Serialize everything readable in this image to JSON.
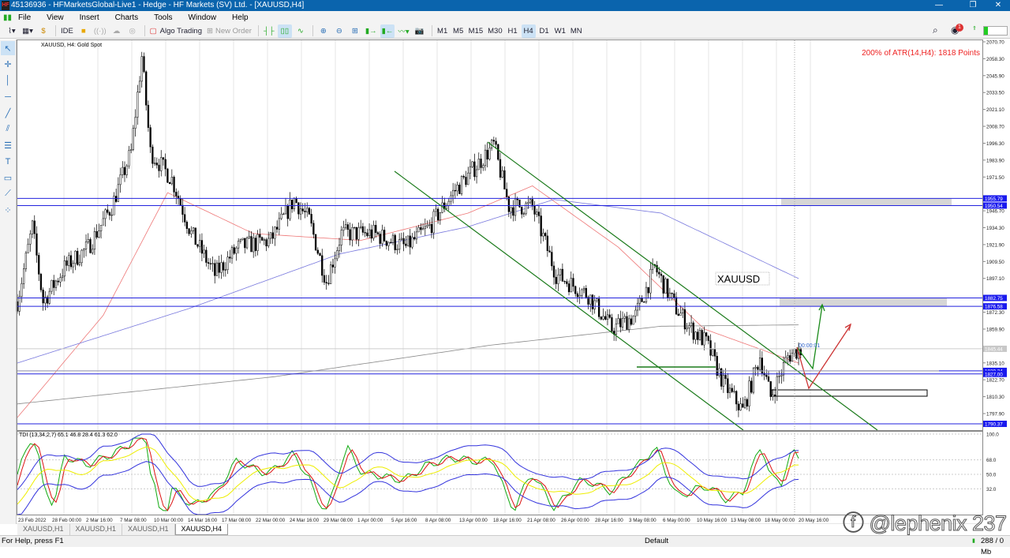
{
  "window": {
    "title": "45136936 - HFMarketsGlobal-Live1 - Hedge - HF Markets (SV) Ltd. - [XAUUSD,H4]",
    "logo": "HF"
  },
  "menu": [
    "File",
    "View",
    "Insert",
    "Charts",
    "Tools",
    "Window",
    "Help"
  ],
  "toolbar": {
    "ide": "IDE",
    "algo_trading": "Algo Trading",
    "new_order": "New Order",
    "timeframes": [
      "M1",
      "M5",
      "M15",
      "M30",
      "H1",
      "H4",
      "D1",
      "W1",
      "MN"
    ],
    "active_timeframe": "H4",
    "notifications": "1"
  },
  "chart": {
    "symbol_label": "XAUUSD, H4:  Gold Spot",
    "atr_text": "200% of ATR(14,H4): 1818  Points",
    "object_label": "XAUUSD",
    "countdown": "00:00:01",
    "indicator_label": "TDI (13,34,2,7) 65.1 46.8 28.4 61.3 62.0",
    "price_ticks": [
      "2070.70",
      "2058.30",
      "2045.90",
      "2033.50",
      "2021.10",
      "2008.70",
      "1996.30",
      "1983.90",
      "1971.50",
      "1946.70",
      "1934.30",
      "1921.90",
      "1909.50",
      "1897.10",
      "1872.30",
      "1859.90",
      "1835.10",
      "1822.70",
      "1810.30",
      "1797.90"
    ],
    "levels": [
      {
        "price": 1955.79,
        "label": "1955.79"
      },
      {
        "price": 1950.54,
        "label": "1950.54"
      },
      {
        "price": 1882.75,
        "label": "1882.75"
      },
      {
        "price": 1876.58,
        "label": "1876.58"
      },
      {
        "price": 1829.24,
        "label": "1829.24"
      },
      {
        "price": 1827.0,
        "label": "1827.00"
      },
      {
        "price": 1790.37,
        "label": "1790.37"
      }
    ],
    "bid": {
      "price": 1845.44,
      "label": "1845.44"
    },
    "indicator_ticks": [
      "100.0",
      "68.0",
      "50.0",
      "32.0"
    ],
    "time_labels": [
      "23 Feb 2022",
      "28 Feb 00:00",
      "2 Mar 16:00",
      "7 Mar 08:00",
      "10 Mar 00:00",
      "14 Mar 16:00",
      "17 Mar 08:00",
      "22 Mar 00:00",
      "24 Mar 16:00",
      "29 Mar 08:00",
      "1 Apr 00:00",
      "5 Apr 16:00",
      "8 Apr 08:00",
      "13 Apr 00:00",
      "18 Apr 16:00",
      "21 Apr 08:00",
      "26 Apr 00:00",
      "28 Apr 16:00",
      "3 May 08:00",
      "6 May 00:00",
      "10 May 16:00",
      "13 May 08:00",
      "18 May 00:00",
      "20 May 16:00"
    ]
  },
  "chart_data": {
    "type": "candlestick",
    "symbol": "XAUUSD",
    "timeframe": "H4",
    "ylim": [
      1785,
      2075
    ],
    "close_waypoints": [
      [
        0,
        1880
      ],
      [
        7,
        1935
      ],
      [
        12,
        1880
      ],
      [
        22,
        1905
      ],
      [
        33,
        1920
      ],
      [
        44,
        1950
      ],
      [
        53,
        1990
      ],
      [
        58,
        2060
      ],
      [
        62,
        1990
      ],
      [
        72,
        1970
      ],
      [
        81,
        1930
      ],
      [
        92,
        1900
      ],
      [
        103,
        1920
      ],
      [
        118,
        1925
      ],
      [
        129,
        1955
      ],
      [
        136,
        1940
      ],
      [
        144,
        1895
      ],
      [
        151,
        1930
      ],
      [
        166,
        1930
      ],
      [
        181,
        1920
      ],
      [
        192,
        1935
      ],
      [
        203,
        1960
      ],
      [
        214,
        1980
      ],
      [
        222,
        1995
      ],
      [
        229,
        1950
      ],
      [
        240,
        1950
      ],
      [
        251,
        1900
      ],
      [
        266,
        1885
      ],
      [
        277,
        1860
      ],
      [
        288,
        1870
      ],
      [
        297,
        1905
      ],
      [
        307,
        1875
      ],
      [
        314,
        1860
      ],
      [
        321,
        1850
      ],
      [
        329,
        1820
      ],
      [
        338,
        1800
      ],
      [
        346,
        1840
      ],
      [
        351,
        1810
      ],
      [
        359,
        1840
      ],
      [
        364,
        1845
      ]
    ],
    "ma_red": [
      [
        0,
        1795
      ],
      [
        40,
        1870
      ],
      [
        70,
        1960
      ],
      [
        110,
        1930
      ],
      [
        160,
        1925
      ],
      [
        210,
        1945
      ],
      [
        240,
        1965
      ],
      [
        280,
        1920
      ],
      [
        320,
        1860
      ],
      [
        364,
        1835
      ]
    ],
    "ma_blue": [
      [
        0,
        1835
      ],
      [
        80,
        1875
      ],
      [
        150,
        1915
      ],
      [
        210,
        1935
      ],
      [
        250,
        1955
      ],
      [
        300,
        1945
      ],
      [
        340,
        1915
      ],
      [
        364,
        1897
      ]
    ],
    "ma_gray": [
      [
        0,
        1805
      ],
      [
        120,
        1825
      ],
      [
        220,
        1848
      ],
      [
        300,
        1862
      ],
      [
        364,
        1863
      ]
    ]
  },
  "tabs": [
    "XAUUSD,H1",
    "XAUUSD,H1",
    "XAUUSD,H1",
    "XAUUSD,H4"
  ],
  "status": {
    "help": "For Help, press F1",
    "profile": "Default",
    "traffic": "288 / 0 Mb"
  },
  "watermark": "ⓕ @lephenix 237"
}
